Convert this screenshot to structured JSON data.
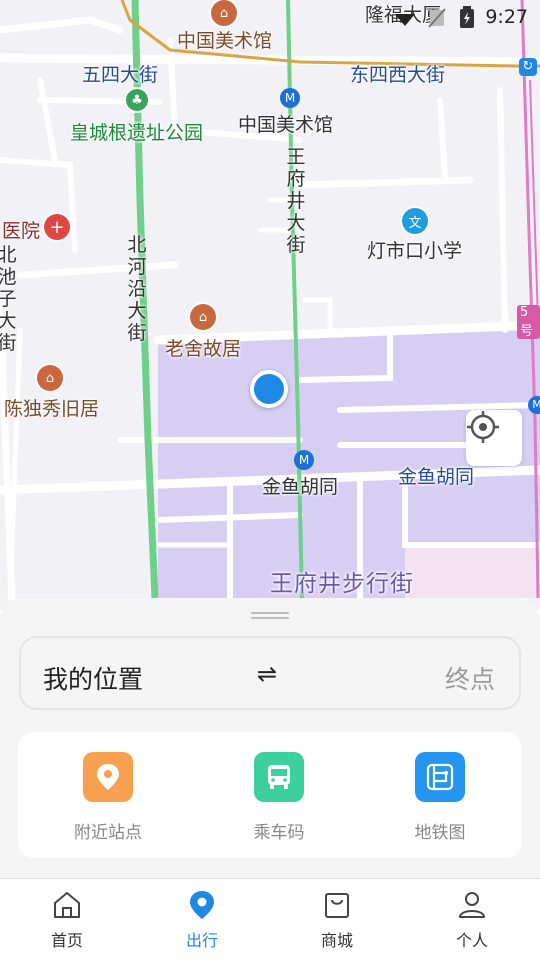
{
  "status_bar": {
    "time": "9:27"
  },
  "map": {
    "labels": {
      "national_art_museum_poi": "中国美术馆",
      "wusi_street": "五四大街",
      "dongsi_west_street": "东四西大街",
      "huangcheng_park": "皇城根遗址公园",
      "national_art_museum_station": "中国美术馆",
      "wangfujing_street": "王府井大街",
      "hospital": "医院",
      "dengshikou_school": "灯市口小学",
      "beiheyan_street": "北河沿大街",
      "beichizi_street": "北池子大街",
      "laoshe_residence": "老舍故居",
      "chen_duxiu_residence": "陈独秀旧居",
      "jinyu_hutong_station": "金鱼胡同",
      "jinyu_hutong": "金鱼胡同",
      "wangfujing_pedestrian": "王府井步行街",
      "longfu_building": "隆福大厦",
      "line5_badge": "5号"
    }
  },
  "route": {
    "from": "我的位置",
    "swap_symbol": "⇌",
    "to": "终点"
  },
  "services": [
    {
      "label": "附近站点",
      "icon": "location-pin-icon",
      "color": "#f7a04f"
    },
    {
      "label": "乘车码",
      "icon": "bus-icon",
      "color": "#3ecf9f"
    },
    {
      "label": "地铁图",
      "icon": "metro-map-icon",
      "color": "#2596f0"
    }
  ],
  "tabs": [
    {
      "label": "首页",
      "icon": "home-icon"
    },
    {
      "label": "出行",
      "icon": "location-icon",
      "active": true
    },
    {
      "label": "商城",
      "icon": "shopping-bag-icon"
    },
    {
      "label": "个人",
      "icon": "person-icon"
    }
  ],
  "colors": {
    "accent": "#1e88e5",
    "map_area": "#d8d0f5",
    "location_dot": "#1e88e5"
  }
}
